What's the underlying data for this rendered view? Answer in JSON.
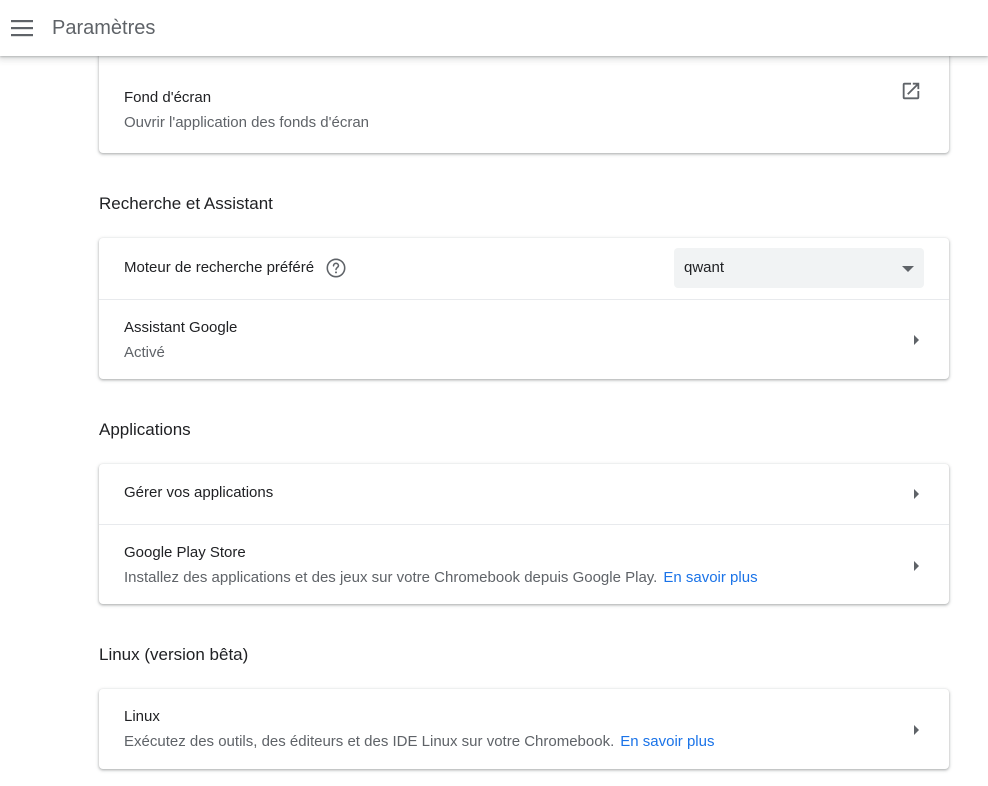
{
  "header": {
    "title": "Paramètres",
    "menu_icon": "hamburger-menu-icon"
  },
  "wallpaper_card": {
    "title": "Fond d'écran",
    "subtitle": "Ouvrir l'application des fonds d'écran",
    "icon": "open-in-new-icon"
  },
  "search_section": {
    "heading": "Recherche et Assistant",
    "search_engine": {
      "label": "Moteur de recherche préféré",
      "help_icon": "help-circle-icon",
      "selected": "qwant"
    },
    "assistant": {
      "title": "Assistant Google",
      "status": "Activé"
    }
  },
  "apps_section": {
    "heading": "Applications",
    "manage": {
      "title": "Gérer vos applications"
    },
    "play_store": {
      "title": "Google Play Store",
      "description": "Installez des applications et des jeux sur votre Chromebook depuis Google Play.",
      "link": "En savoir plus"
    }
  },
  "linux_section": {
    "heading": "Linux (version bêta)",
    "linux": {
      "title": "Linux",
      "description": "Exécutez des outils, des éditeurs et des IDE Linux sur votre Chromebook.",
      "link": "En savoir plus"
    }
  },
  "colors": {
    "link": "#1a73e8",
    "secondary_text": "#5f6368",
    "primary_text": "#202124"
  }
}
